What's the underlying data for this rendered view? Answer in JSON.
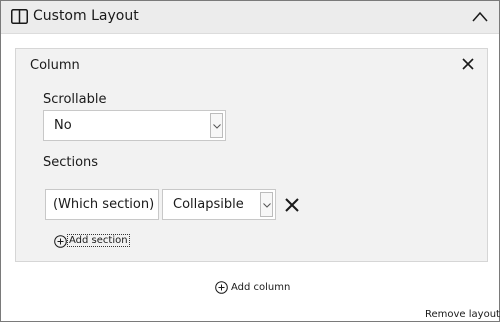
{
  "panel": {
    "title": "Custom Layout"
  },
  "column": {
    "title": "Column",
    "scrollable": {
      "label": "Scrollable",
      "value": "No"
    },
    "sections": {
      "label": "Sections",
      "rows": [
        {
          "name_value": "(Which section)",
          "mode_value": "Collapsible"
        }
      ],
      "add_label": "Add section"
    }
  },
  "add_column_label": "Add column",
  "remove_layout_label": "Remove layout",
  "icons": {
    "layout": "layout-columns-icon",
    "collapse": "chevron-up-icon",
    "close": "close-icon",
    "add": "plus-circle-icon",
    "dropdown": "chevron-down-icon"
  }
}
